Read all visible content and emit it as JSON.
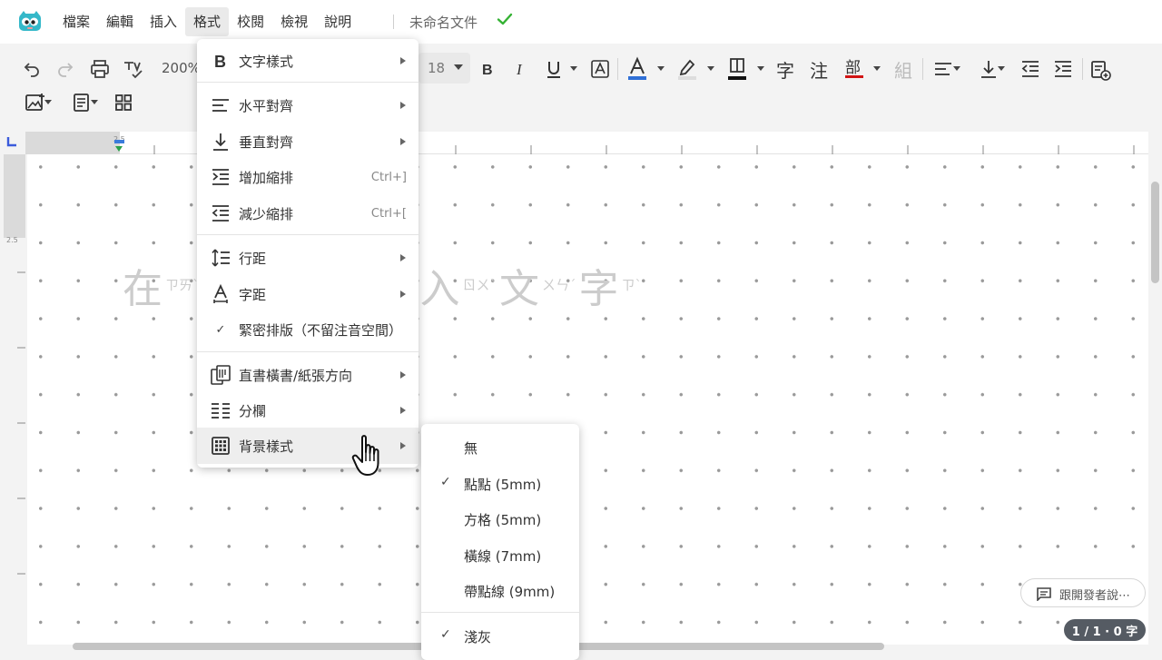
{
  "menubar": {
    "items": [
      "檔案",
      "編輯",
      "插入",
      "格式",
      "校閱",
      "檢視",
      "說明"
    ],
    "active_index": 3,
    "doc_title": "未命名文件",
    "saved_icon": "check-icon"
  },
  "toolbar": {
    "zoom": "200%",
    "font_size": "18",
    "glyph_zi": "字",
    "glyph_zhu": "注",
    "glyph_bu": "部",
    "glyph_zu": "組",
    "colors": {
      "text_color": "#2f6fd6",
      "highlight": "#dddddd",
      "border": "#111111",
      "radical": "#d11414"
    }
  },
  "ruler": {
    "top_label": "2.5",
    "left_label": "2.5"
  },
  "document": {
    "placeholder": "在這裡輸入文字",
    "placeholder_visible_right": "入文字",
    "placeholder_left": "在",
    "zhuyin": [
      "ㄗㄞˋ",
      "ㄖㄨˋ",
      "ㄨㄣˊ",
      "ㄗˋ"
    ]
  },
  "format_menu": {
    "items": [
      {
        "label": "文字樣式",
        "icon": "bold-icon",
        "submenu": true
      },
      {
        "label": "水平對齊",
        "icon": "align-left-icon",
        "submenu": true
      },
      {
        "label": "垂直對齊",
        "icon": "align-bottom-icon",
        "submenu": true
      },
      {
        "label": "增加縮排",
        "icon": "indent-increase-icon",
        "shortcut": "Ctrl+]"
      },
      {
        "label": "減少縮排",
        "icon": "indent-decrease-icon",
        "shortcut": "Ctrl+["
      },
      {
        "label": "行距",
        "icon": "line-spacing-icon",
        "submenu": true
      },
      {
        "label": "字距",
        "icon": "letter-spacing-icon",
        "submenu": true
      },
      {
        "label": "緊密排版（不留注音空間）",
        "icon": "check-icon",
        "checked": true
      },
      {
        "label": "直書橫書/紙張方向",
        "icon": "page-orientation-icon",
        "submenu": true
      },
      {
        "label": "分欄",
        "icon": "columns-icon",
        "submenu": true
      },
      {
        "label": "背景樣式",
        "icon": "grid-icon",
        "submenu": true,
        "hover": true
      }
    ]
  },
  "background_submenu": {
    "items": [
      {
        "label": "無",
        "checked": false
      },
      {
        "label": "點點 (5mm)",
        "checked": true
      },
      {
        "label": "方格 (5mm)",
        "checked": false
      },
      {
        "label": "橫線 (7mm)",
        "checked": false
      },
      {
        "label": "帶點線 (9mm)",
        "checked": false
      },
      {
        "label": "淺灰",
        "checked": true
      }
    ],
    "check_mark": "✓"
  },
  "feedback": {
    "label": "跟開發者說⋯"
  },
  "status": {
    "word_count": "1 / 1 · 0 字"
  }
}
